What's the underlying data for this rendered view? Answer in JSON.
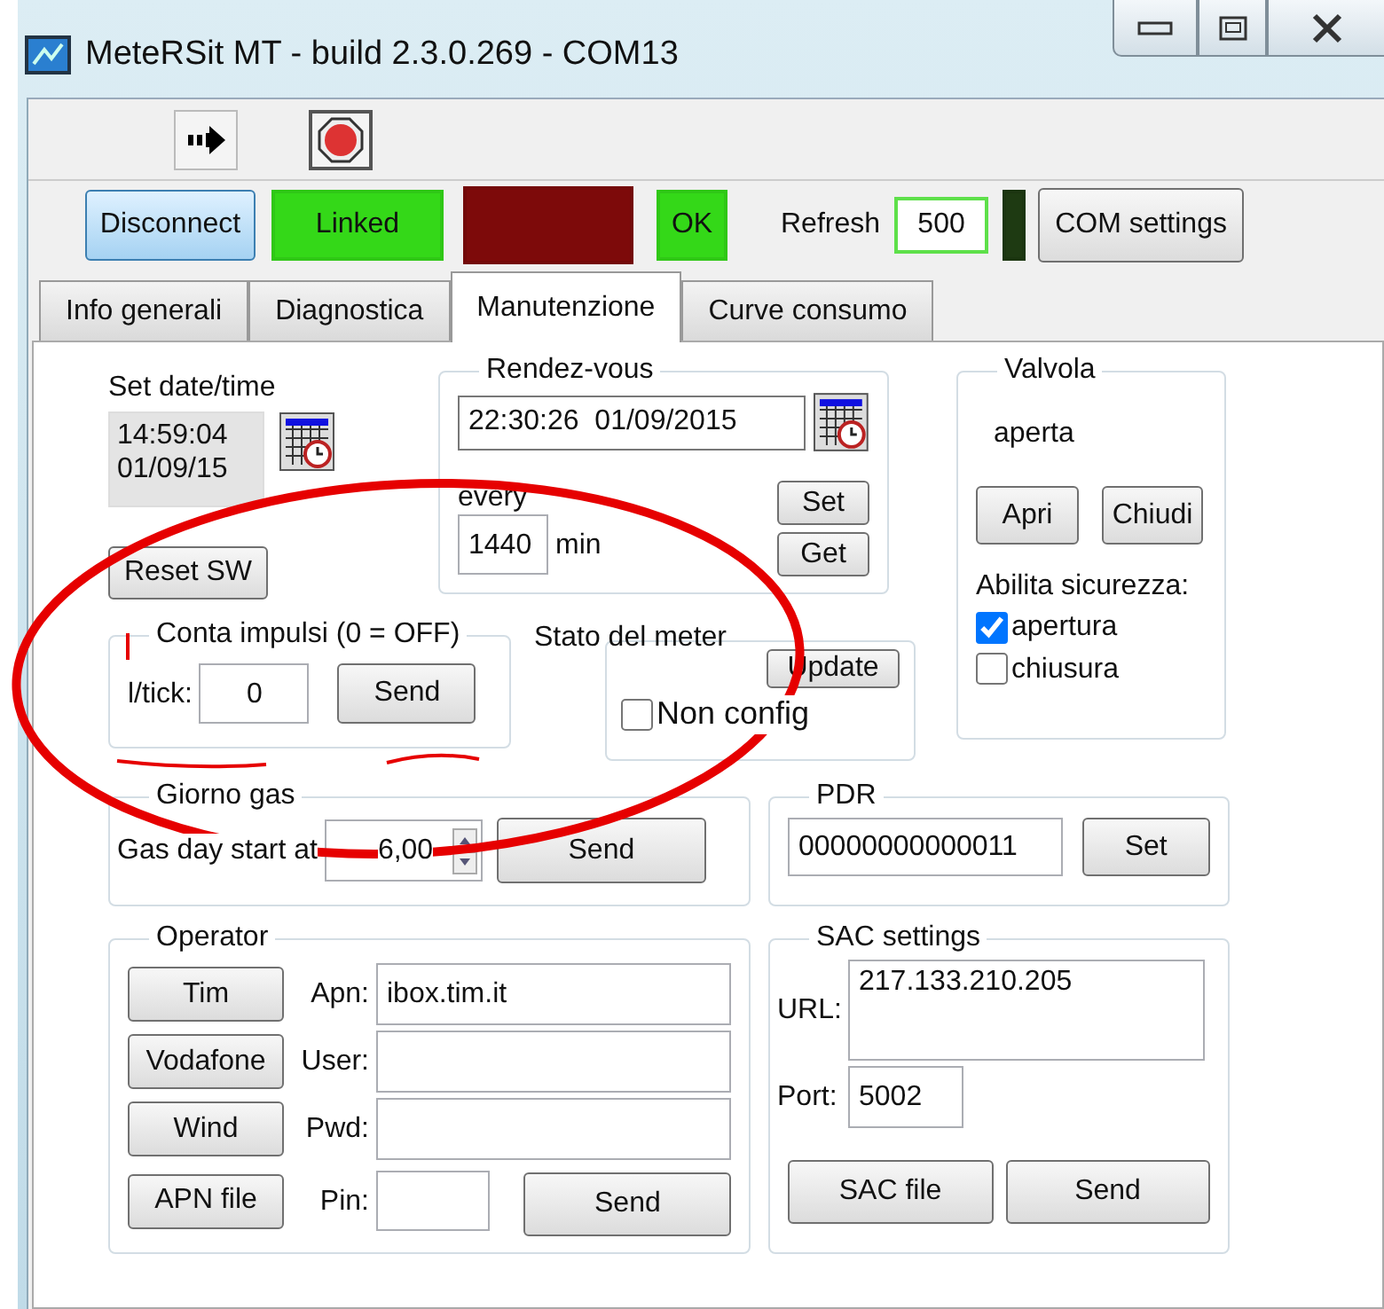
{
  "window": {
    "title": "MeteRSit MT - build 2.3.0.269 - COM13"
  },
  "connection": {
    "disconnect_button": "Disconnect",
    "refresh_label": "Refresh",
    "refresh_value": "500",
    "com_settings_button": "COM settings",
    "indicators": [
      {
        "label": "Linked",
        "color": "#34d818"
      },
      {
        "color": "#7d0a0a"
      },
      {
        "label": "OK",
        "color": "#34d818"
      },
      {
        "color": "#1e3a12"
      }
    ]
  },
  "tabs": [
    {
      "label": "Info generali",
      "selected": false
    },
    {
      "label": "Diagnostica",
      "selected": false
    },
    {
      "label": "Manutenzione",
      "selected": true
    },
    {
      "label": "Curve consumo",
      "selected": false
    }
  ],
  "set_datetime": {
    "label": "Set date/time",
    "time": "14:59:04",
    "date": "01/09/15",
    "reset_button": "Reset SW"
  },
  "rendezvous": {
    "title": "Rendez-vous",
    "datetime": "22:30:26  01/09/2015",
    "every_label": "every",
    "every_value": "1440",
    "unit": "min",
    "set_button": "Set",
    "get_button": "Get"
  },
  "valve": {
    "title": "Valvola",
    "state": "aperta",
    "open_button": "Apri",
    "close_button": "Chiudi",
    "safety_label": "Abilita sicurezza:",
    "safety": [
      {
        "label": "apertura",
        "checked": true
      },
      {
        "label": "chiusura",
        "checked": false
      }
    ]
  },
  "pulse_counter": {
    "title": "Conta impulsi (0 = OFF)",
    "field_label": "l/tick:",
    "value": "0",
    "send_button": "Send"
  },
  "meter_state": {
    "title": "Stato del meter",
    "update_button": "Update",
    "non_config": {
      "label": "Non config",
      "checked": false
    }
  },
  "gas_day": {
    "title": "Giorno gas",
    "label": "Gas day start at",
    "value": "6,00",
    "send_button": "Send"
  },
  "pdr": {
    "title": "PDR",
    "value": "00000000000011",
    "set_button": "Set"
  },
  "operator": {
    "title": "Operator",
    "buttons": [
      "Tim",
      "Vodafone",
      "Wind",
      "APN file"
    ],
    "fields": [
      {
        "label": "Apn:",
        "value": "ibox.tim.it"
      },
      {
        "label": "User:"
      },
      {
        "label": "Pwd:"
      },
      {
        "label": "Pin:"
      }
    ],
    "send_button": "Send"
  },
  "sac": {
    "title": "SAC settings",
    "url_label": "URL:",
    "url": "217.133.210.205",
    "port_label": "Port:",
    "port": "5002",
    "file_button": "SAC file",
    "send_button": "Send"
  }
}
